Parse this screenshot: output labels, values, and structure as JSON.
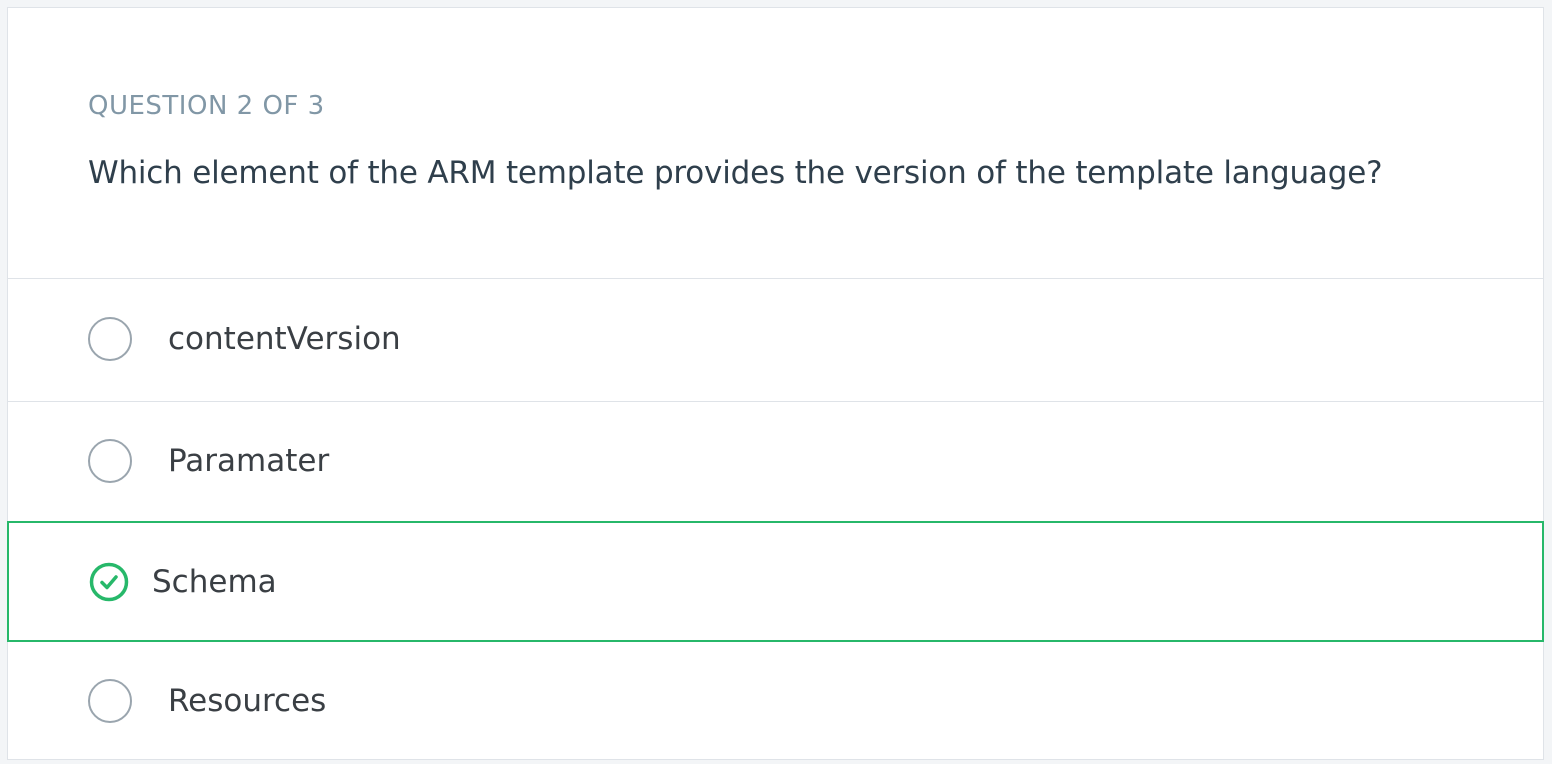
{
  "question": {
    "counter": "QUESTION 2 OF 3",
    "text": "Which element of the ARM template provides the version of the template language?"
  },
  "options": [
    {
      "label": "contentVersion",
      "state": "unselected"
    },
    {
      "label": "Paramater",
      "state": "unselected"
    },
    {
      "label": "Schema",
      "state": "correct"
    },
    {
      "label": "Resources",
      "state": "unselected"
    }
  ],
  "colors": {
    "correct": "#27b86a",
    "radio_border": "#9aa5ae",
    "counter_text": "#8197a6",
    "question_text": "#2f3f4c",
    "divider": "#dfe3e8"
  }
}
